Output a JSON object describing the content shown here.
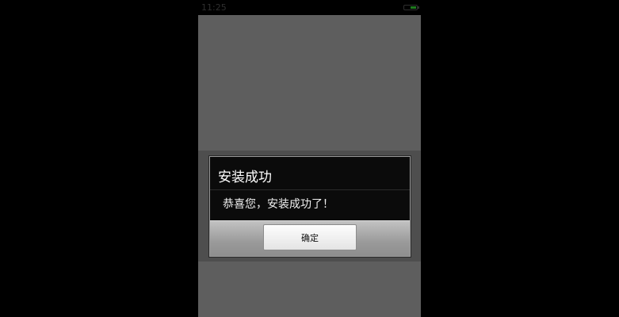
{
  "status_bar": {
    "time": "11:25"
  },
  "dialog": {
    "title": "安装成功",
    "message": "恭喜您，安装成功了！",
    "ok_label": "确定"
  },
  "colors": {
    "screen_bg": "#5e5e5e",
    "dialog_bg": "#0b0b0b",
    "button_bar": "#9a9a9a"
  }
}
